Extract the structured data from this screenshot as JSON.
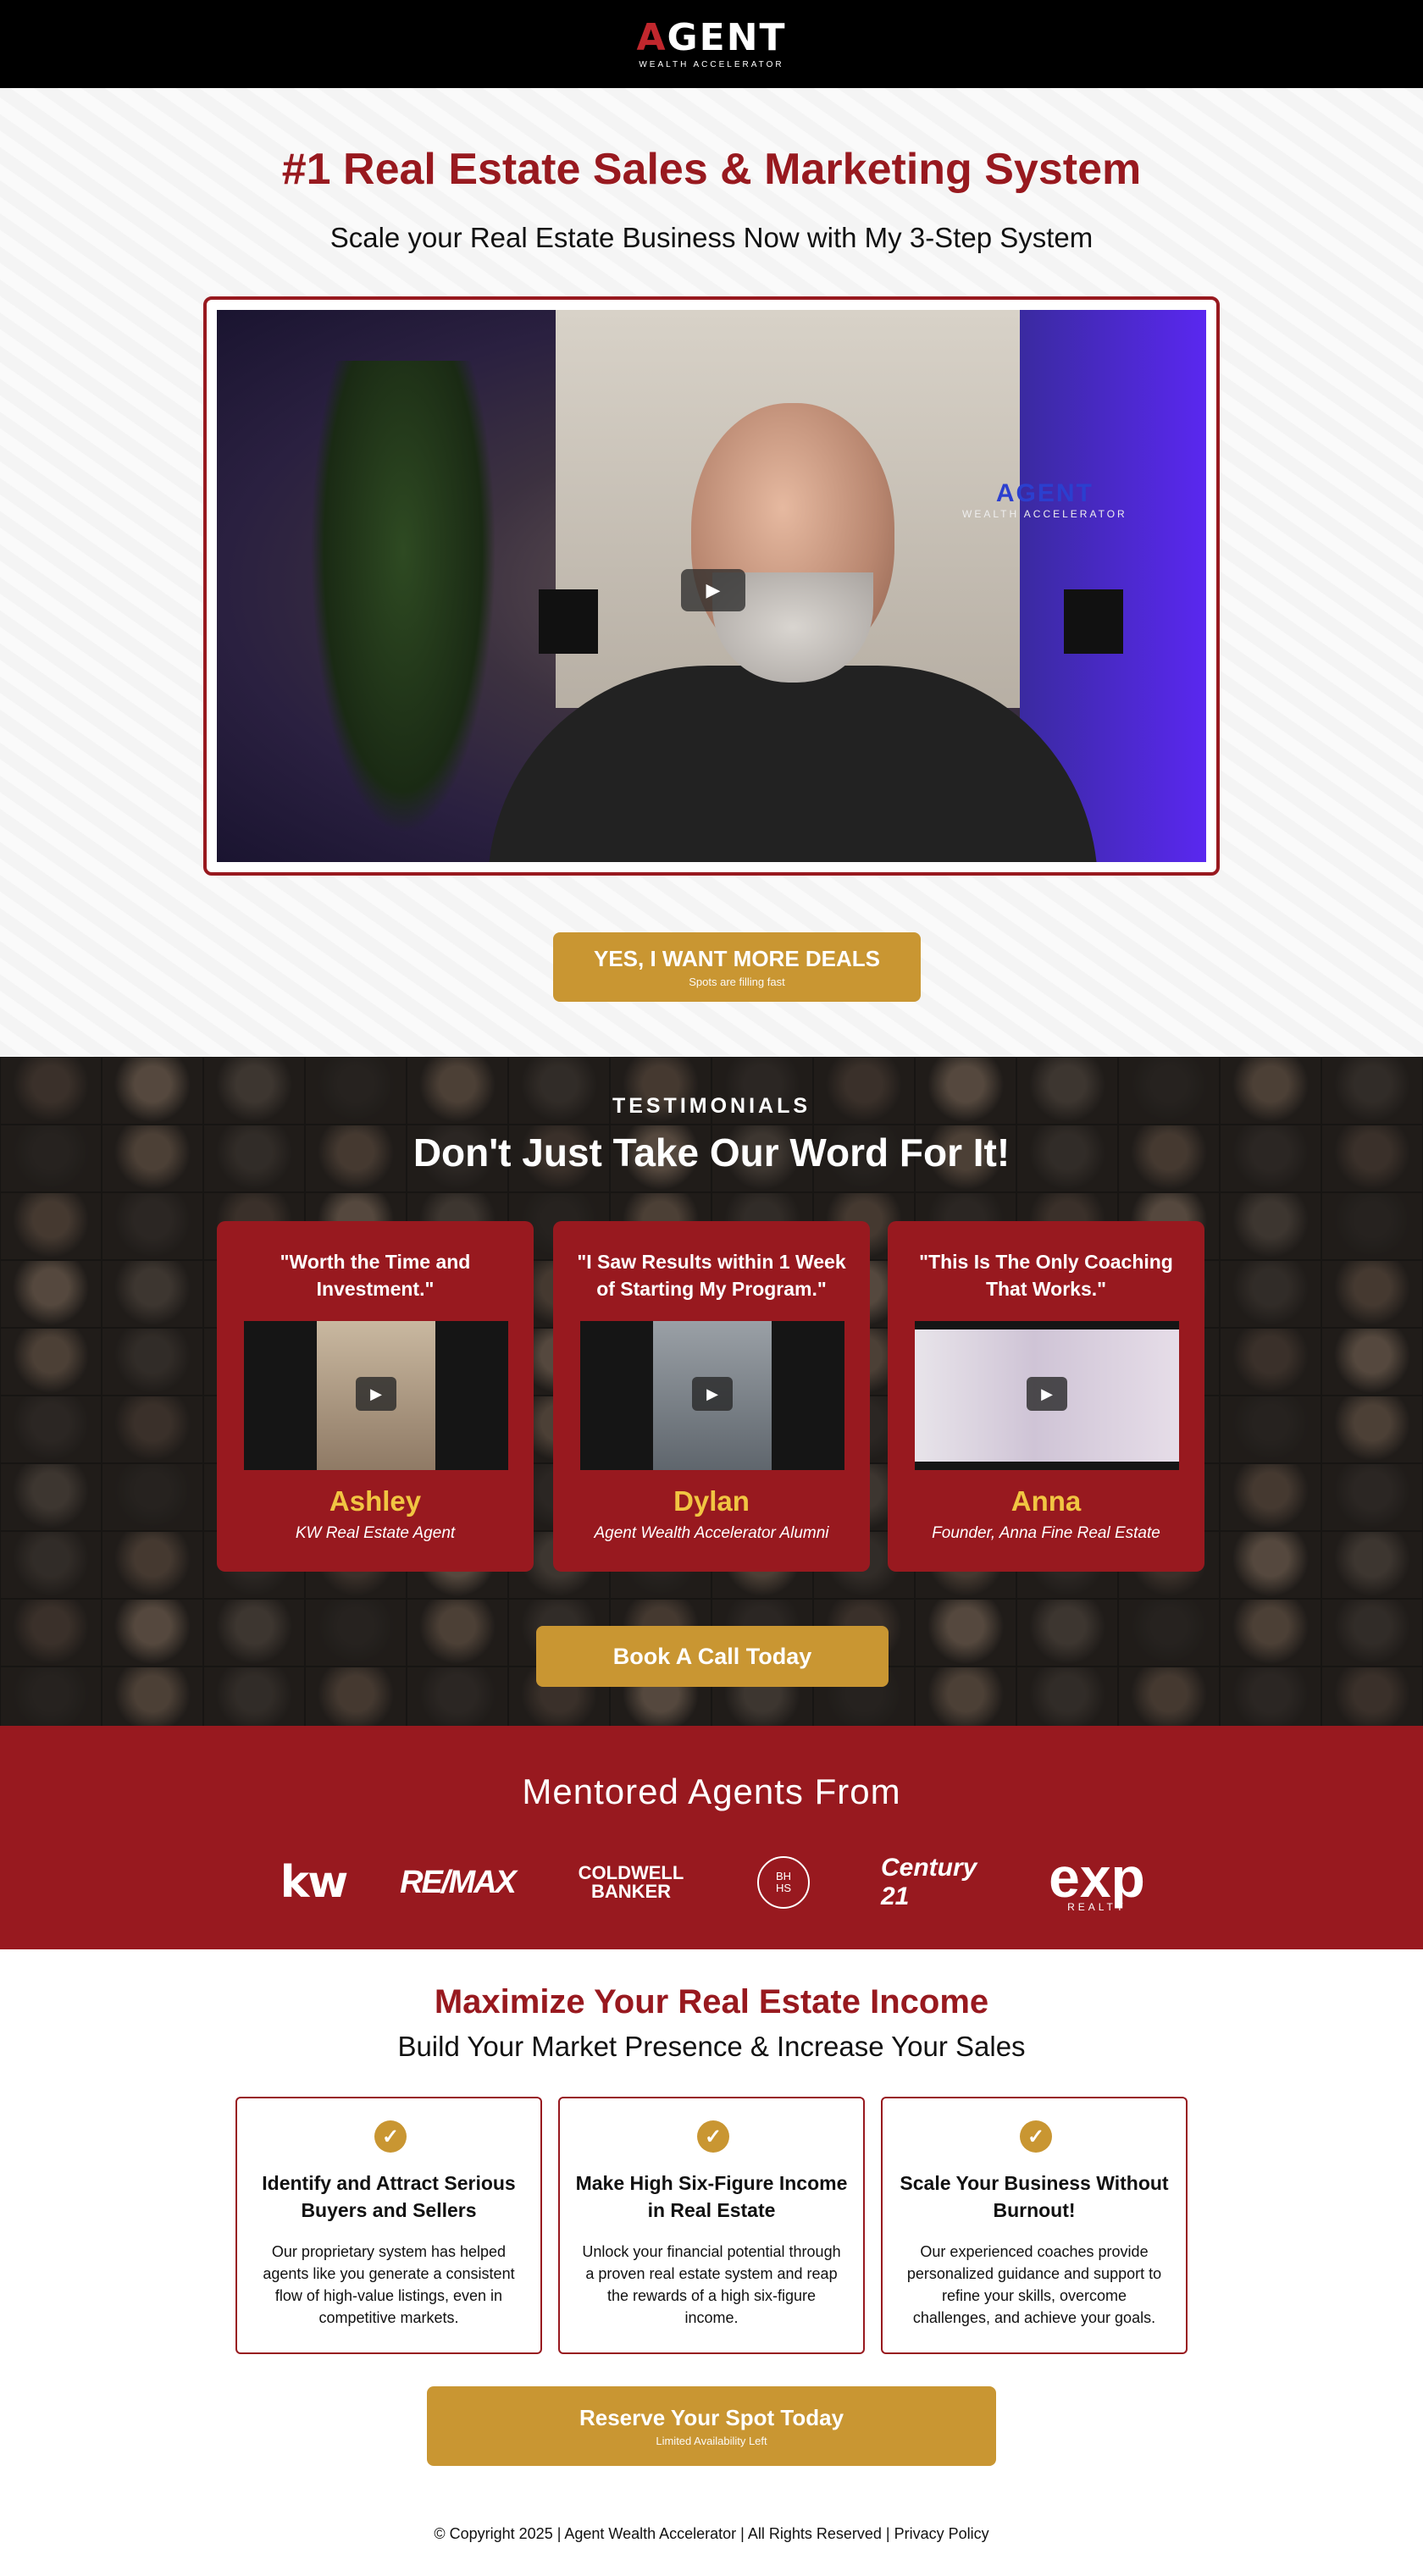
{
  "header": {
    "logo_word_a": "A",
    "logo_word_rest": "GENT",
    "logo_sub": "WEALTH ACCELERATOR"
  },
  "hero": {
    "title": "#1 Real Estate Sales & Marketing System",
    "subtitle": "Scale your Real Estate Business Now with My 3-Step System",
    "video_wall_logo_top": "AGENT",
    "video_wall_logo_bottom": "WEALTH ACCELERATOR",
    "play_icon": "play-icon",
    "cta_label": "YES, I WANT MORE DEALS",
    "cta_sub": "Spots are filling fast"
  },
  "testimonials": {
    "kicker": "TESTIMONIALS",
    "title": "Don't Just Take Our Word For It!",
    "cards": [
      {
        "quote": "\"Worth the Time and Investment.\"",
        "name": "Ashley",
        "role": "KW Real Estate Agent"
      },
      {
        "quote": "\"I Saw Results within 1 Week of Starting My Program.\"",
        "name": "Dylan",
        "role": "Agent Wealth Accelerator Alumni"
      },
      {
        "quote": "\"This Is The Only Coaching That Works.\"",
        "name": "Anna",
        "role": "Founder, Anna Fine Real Estate"
      }
    ],
    "cta_label": "Book A Call Today"
  },
  "mentored": {
    "title": "Mentored Agents From",
    "brands": {
      "kw": "kw",
      "remax": "RE/MAX",
      "cb_top": "COLDWELL",
      "cb_bottom": "BANKER",
      "bhhs_top": "BH",
      "bhhs_bottom": "HS",
      "c21": "Century 21",
      "exp": "exp",
      "exp_sub": "REALTY"
    }
  },
  "maximize": {
    "title": "Maximize Your Real Estate Income",
    "subtitle": "Build Your Market Presence & Increase Your Sales",
    "features": [
      {
        "title": "Identify and Attract Serious Buyers and Sellers",
        "body": "Our proprietary system has helped agents like you generate a consistent flow of high-value listings, even in competitive markets."
      },
      {
        "title": "Make High Six-Figure Income in Real Estate",
        "body": "Unlock your financial potential through a proven real estate system and reap the rewards of a high six-figure income."
      },
      {
        "title": "Scale Your Business Without Burnout!",
        "body": "Our experienced coaches provide personalized guidance and support to refine your skills, overcome challenges, and achieve your goals."
      }
    ],
    "cta_label": "Reserve Your Spot Today",
    "cta_sub": "Limited Availability Left"
  },
  "footer": {
    "copyright": "© Copyright 2025 | Agent Wealth Accelerator | All Rights Reserved | Privacy Policy"
  },
  "colors": {
    "brand_red": "#98191f",
    "gold": "#c99632",
    "name_yellow": "#f1c542"
  }
}
